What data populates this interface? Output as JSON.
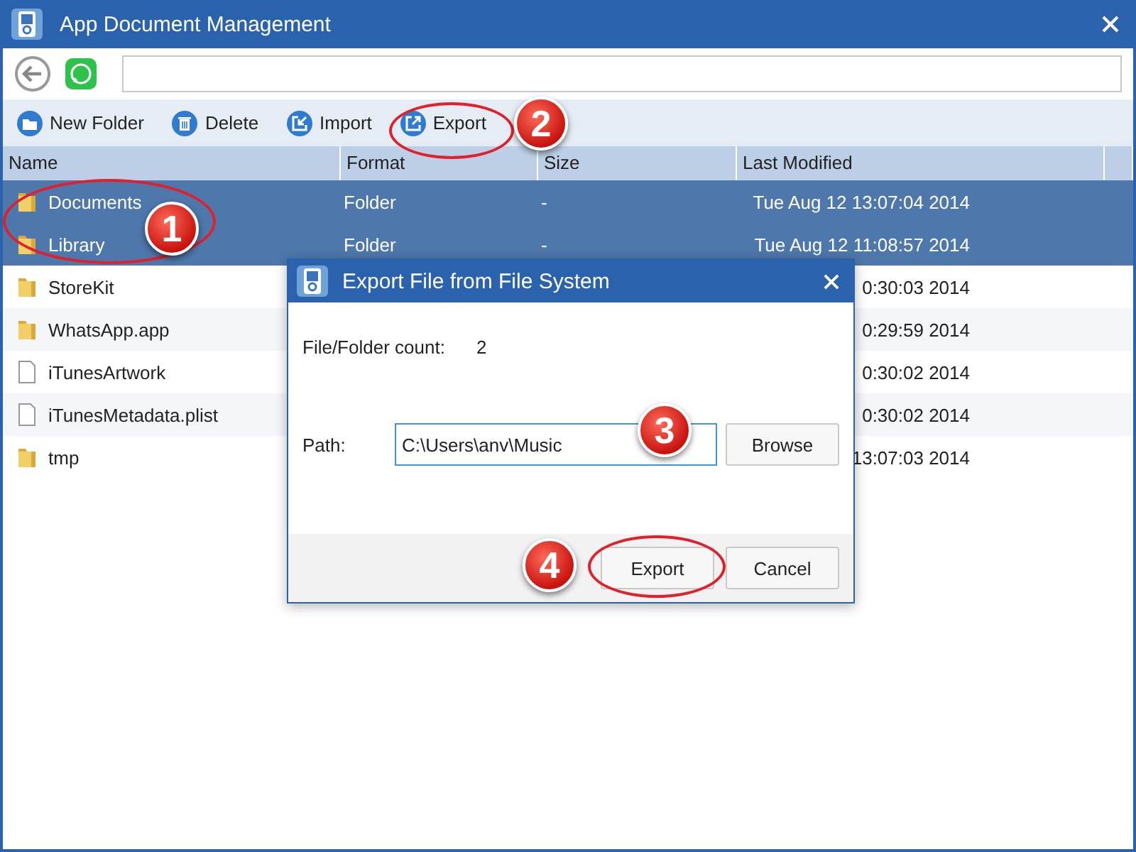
{
  "window": {
    "title": "App Document Management"
  },
  "toolbar": [
    {
      "kind": "new-folder",
      "label": "New Folder"
    },
    {
      "kind": "delete",
      "label": "Delete"
    },
    {
      "kind": "import",
      "label": "Import"
    },
    {
      "kind": "export",
      "label": "Export"
    }
  ],
  "table": {
    "columns": [
      "Name",
      "Format",
      "Size",
      "Last Modified"
    ],
    "rows": [
      {
        "kind": "folder",
        "name": "Documents",
        "format": "Folder",
        "size": "-",
        "modified": "Tue Aug 12 13:07:04 2014",
        "selected": true
      },
      {
        "kind": "folder",
        "name": "Library",
        "format": "Folder",
        "size": "-",
        "modified": "Tue Aug 12 11:08:57 2014",
        "selected": true
      },
      {
        "kind": "folder",
        "name": "StoreKit",
        "modified": "0:30:03 2014",
        "selected": false
      },
      {
        "kind": "folder",
        "name": "WhatsApp.app",
        "modified": "0:29:59 2014",
        "selected": false
      },
      {
        "kind": "file",
        "name": "iTunesArtwork",
        "modified": "0:30:02 2014",
        "selected": false
      },
      {
        "kind": "file",
        "name": "iTunesMetadata.plist",
        "modified": "0:30:02 2014",
        "selected": false
      },
      {
        "kind": "folder",
        "name": "tmp",
        "modified": "13:07:03 2014",
        "selected": false
      }
    ]
  },
  "dialog": {
    "title": "Export File from File System",
    "count_label": "File/Folder count:",
    "count": "2",
    "path_label": "Path:",
    "path": "C:\\Users\\anv\\Music",
    "browse": "Browse",
    "buttons": [
      "Export",
      "Cancel"
    ]
  },
  "annotations": [
    "1",
    "2",
    "3",
    "4"
  ]
}
